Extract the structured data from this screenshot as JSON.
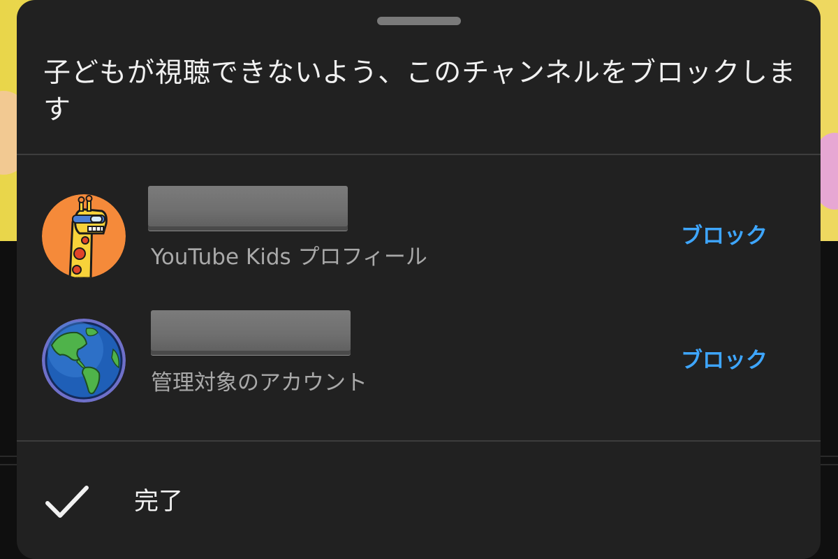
{
  "sheet": {
    "title": "子どもが視聴できないよう、このチャンネルをブロックします"
  },
  "accounts": [
    {
      "avatar_icon": "giraffe-avatar-icon",
      "subtitle": "YouTube Kids プロフィール",
      "action_label": "ブロック"
    },
    {
      "avatar_icon": "globe-avatar-icon",
      "subtitle": "管理対象のアカウント",
      "action_label": "ブロック"
    }
  ],
  "footer": {
    "done_icon": "checkmark-icon",
    "done_label": "完了"
  },
  "colors": {
    "sheet_bg": "#212121",
    "accent_blue": "#3ea6ff",
    "text_primary": "#f1f1f1",
    "text_secondary": "#a9a9a9"
  }
}
